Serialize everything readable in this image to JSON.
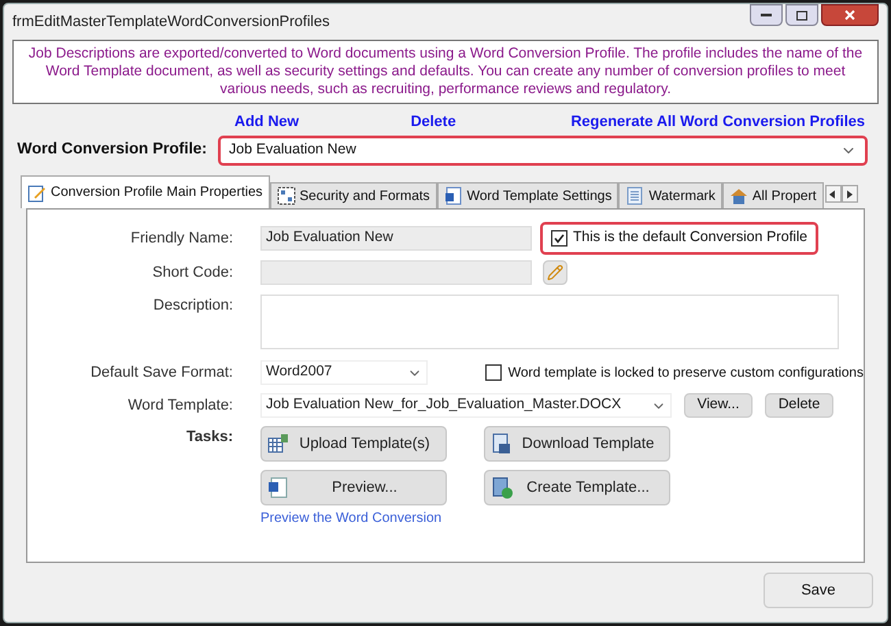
{
  "window": {
    "title": "frmEditMasterTemplateWordConversionProfiles"
  },
  "info": "Job Descriptions are exported/converted to Word documents using a Word Conversion Profile. The profile includes the name of the Word Template document, as well as security settings and defaults.  You can create any number of conversion profiles to meet various needs, such as recruiting, performance reviews and regulatory.",
  "links": [
    "Add New",
    "Delete",
    "Regenerate All Word Conversion Profiles"
  ],
  "profile": {
    "label": "Word Conversion Profile:",
    "value": "Job Evaluation New"
  },
  "tabs": [
    {
      "label": "Conversion Profile Main Properties",
      "selected": true,
      "kind": "edit"
    },
    {
      "label": "Security and Formats",
      "selected": false,
      "kind": "grid"
    },
    {
      "label": "Word Template Settings",
      "selected": false,
      "kind": "word"
    },
    {
      "label": "Watermark",
      "selected": false,
      "kind": "doc"
    },
    {
      "label": "All Propert",
      "selected": false,
      "kind": "house"
    }
  ],
  "form": {
    "friendly_name": {
      "label": "Friendly Name:",
      "value": "Job Evaluation New"
    },
    "default_checkbox": {
      "label": "This is the default Conversion Profile",
      "checked": true
    },
    "short_code": {
      "label": "Short Code:"
    },
    "description": {
      "label": "Description:"
    },
    "save_format": {
      "label": "Default Save Format:",
      "value": "Word2007"
    },
    "locked_checkbox": {
      "label": "Word template is locked to preserve custom configurations",
      "checked": false
    },
    "word_template": {
      "label": "Word Template:",
      "value": "Job Evaluation New_for_Job_Evaluation_Master.DOCX",
      "buttons": [
        "View...",
        "Delete"
      ]
    },
    "tasks": {
      "label": "Tasks:",
      "buttons": [
        {
          "label": "Upload Template(s)",
          "kind": "upload"
        },
        {
          "label": "Download Template",
          "kind": "download"
        },
        {
          "label": "Preview...",
          "kind": "word"
        },
        {
          "label": "Create Template...",
          "kind": "create"
        }
      ],
      "link": "Preview the Word Conversion"
    }
  },
  "save": "Save"
}
